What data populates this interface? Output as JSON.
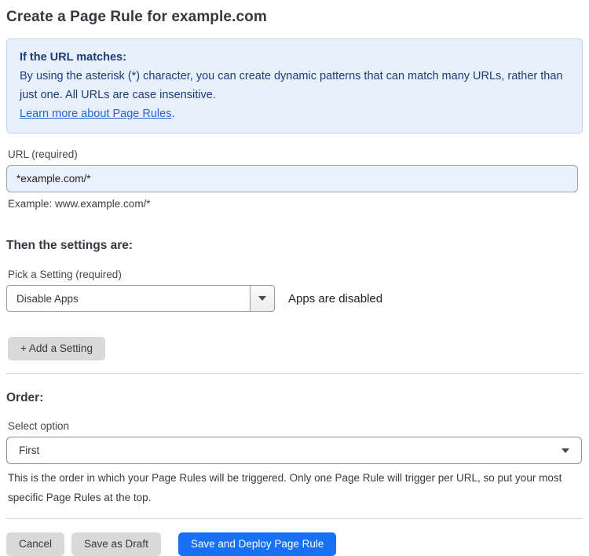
{
  "page": {
    "title": "Create a Page Rule for example.com"
  },
  "info_box": {
    "heading": "If the URL matches:",
    "body": "By using the asterisk (*) character, you can create dynamic patterns that can match many URLs, rather than just one. All URLs are case insensitive.",
    "link_label": "Learn more about Page Rules",
    "link_suffix": "."
  },
  "url_field": {
    "label": "URL (required)",
    "value": "*example.com/*",
    "helper": "Example: www.example.com/*"
  },
  "settings_section": {
    "heading": "Then the settings are:",
    "picker_label": "Pick a Setting (required)",
    "picker_value": "Disable Apps",
    "picker_status": "Apps are disabled",
    "add_setting_label": "+ Add a Setting"
  },
  "order_section": {
    "heading": "Order:",
    "select_label": "Select option",
    "select_value": "First",
    "helper": "This is the order in which your Page Rules will be triggered. Only one Page Rule will trigger per URL, so put your most specific Page Rules at the top."
  },
  "footer": {
    "cancel_label": "Cancel",
    "save_draft_label": "Save as Draft",
    "deploy_label": "Save and Deploy Page Rule"
  },
  "icons": {
    "setting_select_caret": "caret-down-icon",
    "order_select_caret": "caret-down-icon"
  },
  "colors": {
    "accent_blue": "#1671F6",
    "info_bg": "#E8F1FB",
    "info_border": "#BCD4EE",
    "info_text": "#1D3C78",
    "link_blue": "#2B62D9",
    "input_bg": "#E9F1FD",
    "button_gray": "#D9D9D9",
    "text_dark": "#36393F",
    "label_gray": "#47474C"
  }
}
